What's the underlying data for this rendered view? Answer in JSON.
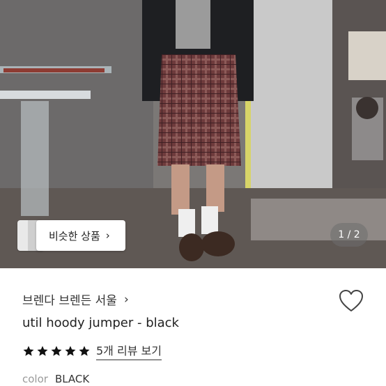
{
  "gallery": {
    "similar_button_label": "비슷한 상품",
    "chevron": "›",
    "pager_text": "1 / 2",
    "icons": [
      "chevron-right-icon"
    ]
  },
  "product": {
    "store_name": "브렌다 브렌든 서울",
    "store_chevron": "›",
    "title": "util hoody jumper - black",
    "rating_stars": 5,
    "review_link": "5개 리뷰 보기",
    "color_label": "color",
    "color_value": "BLACK",
    "icons": [
      "heart-icon",
      "star-icon"
    ]
  },
  "colors": {
    "text": "#222222",
    "muted": "#9a9a9a",
    "star": "#111111"
  }
}
